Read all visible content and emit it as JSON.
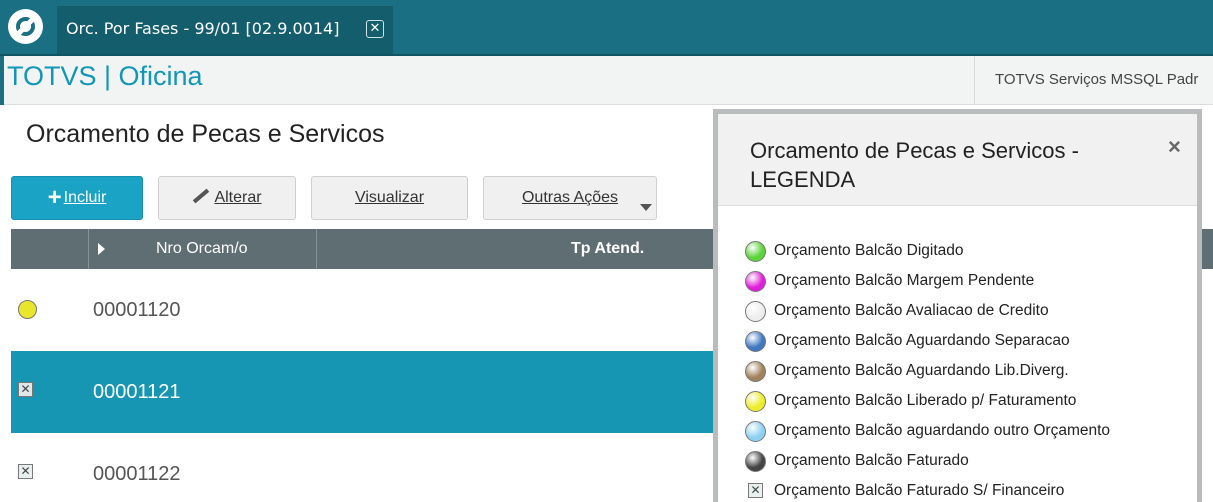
{
  "window": {
    "tab_title": "Orc. Por Fases - 99/01 [02.9.0014]",
    "tab_close_glyph": "✕"
  },
  "app": {
    "title": "TOTVS | Oficina",
    "environment": "TOTVS Serviços MSSQL Padr"
  },
  "page": {
    "title": "Orcamento de Pecas e Servicos"
  },
  "toolbar": {
    "incluir": "Incluir",
    "alterar": "Alterar",
    "visualizar": "Visualizar",
    "outras_acoes": "Outras Ações"
  },
  "grid": {
    "columns": [
      "Nro Orcam/o",
      "Tp Atend."
    ],
    "rows": [
      {
        "status": "yellow-dot",
        "number": "00001120"
      },
      {
        "status": "x-box",
        "number": "00001121",
        "selected": true
      },
      {
        "status": "x-box",
        "number": "00001122"
      }
    ]
  },
  "legend": {
    "title": "Orcamento de Pecas e Servicos - LEGENDA",
    "close_glyph": "×",
    "items": [
      {
        "icon": "green-dot",
        "color": "#5dd33a",
        "label": "Orçamento Balcão Digitado"
      },
      {
        "icon": "magenta-dot",
        "color": "#e020d8",
        "label": "Orçamento Balcão Margem Pendente"
      },
      {
        "icon": "white-dot",
        "color": "#eeeeee",
        "label": "Orçamento Balcão Avaliacao de Credito"
      },
      {
        "icon": "blue-dot",
        "color": "#3f78c0",
        "label": "Orçamento Balcão Aguardando Separacao"
      },
      {
        "icon": "brown-dot",
        "color": "#a0825c",
        "label": "Orçamento Balcão Aguardando Lib.Diverg."
      },
      {
        "icon": "yellow-dot",
        "color": "#ecec2a",
        "label": "Orçamento Balcão Liberado p/ Faturamento"
      },
      {
        "icon": "light-blue-dot",
        "color": "#8ecff2",
        "label": "Orçamento Balcão aguardando outro Orçamento"
      },
      {
        "icon": "black-dot",
        "color": "#444444",
        "label": "Orçamento Balcão Faturado"
      },
      {
        "icon": "x-box",
        "color": "#e8efef",
        "label": "Orçamento Balcão Faturado S/ Financeiro"
      }
    ]
  },
  "colors": {
    "topbar": "#1a6f82",
    "brand_text": "#1296b8",
    "primary_button": "#1aa3c4",
    "selected_row": "#1796b4",
    "grid_header": "#5f6e72",
    "yellow_status": "#e8e62a"
  }
}
